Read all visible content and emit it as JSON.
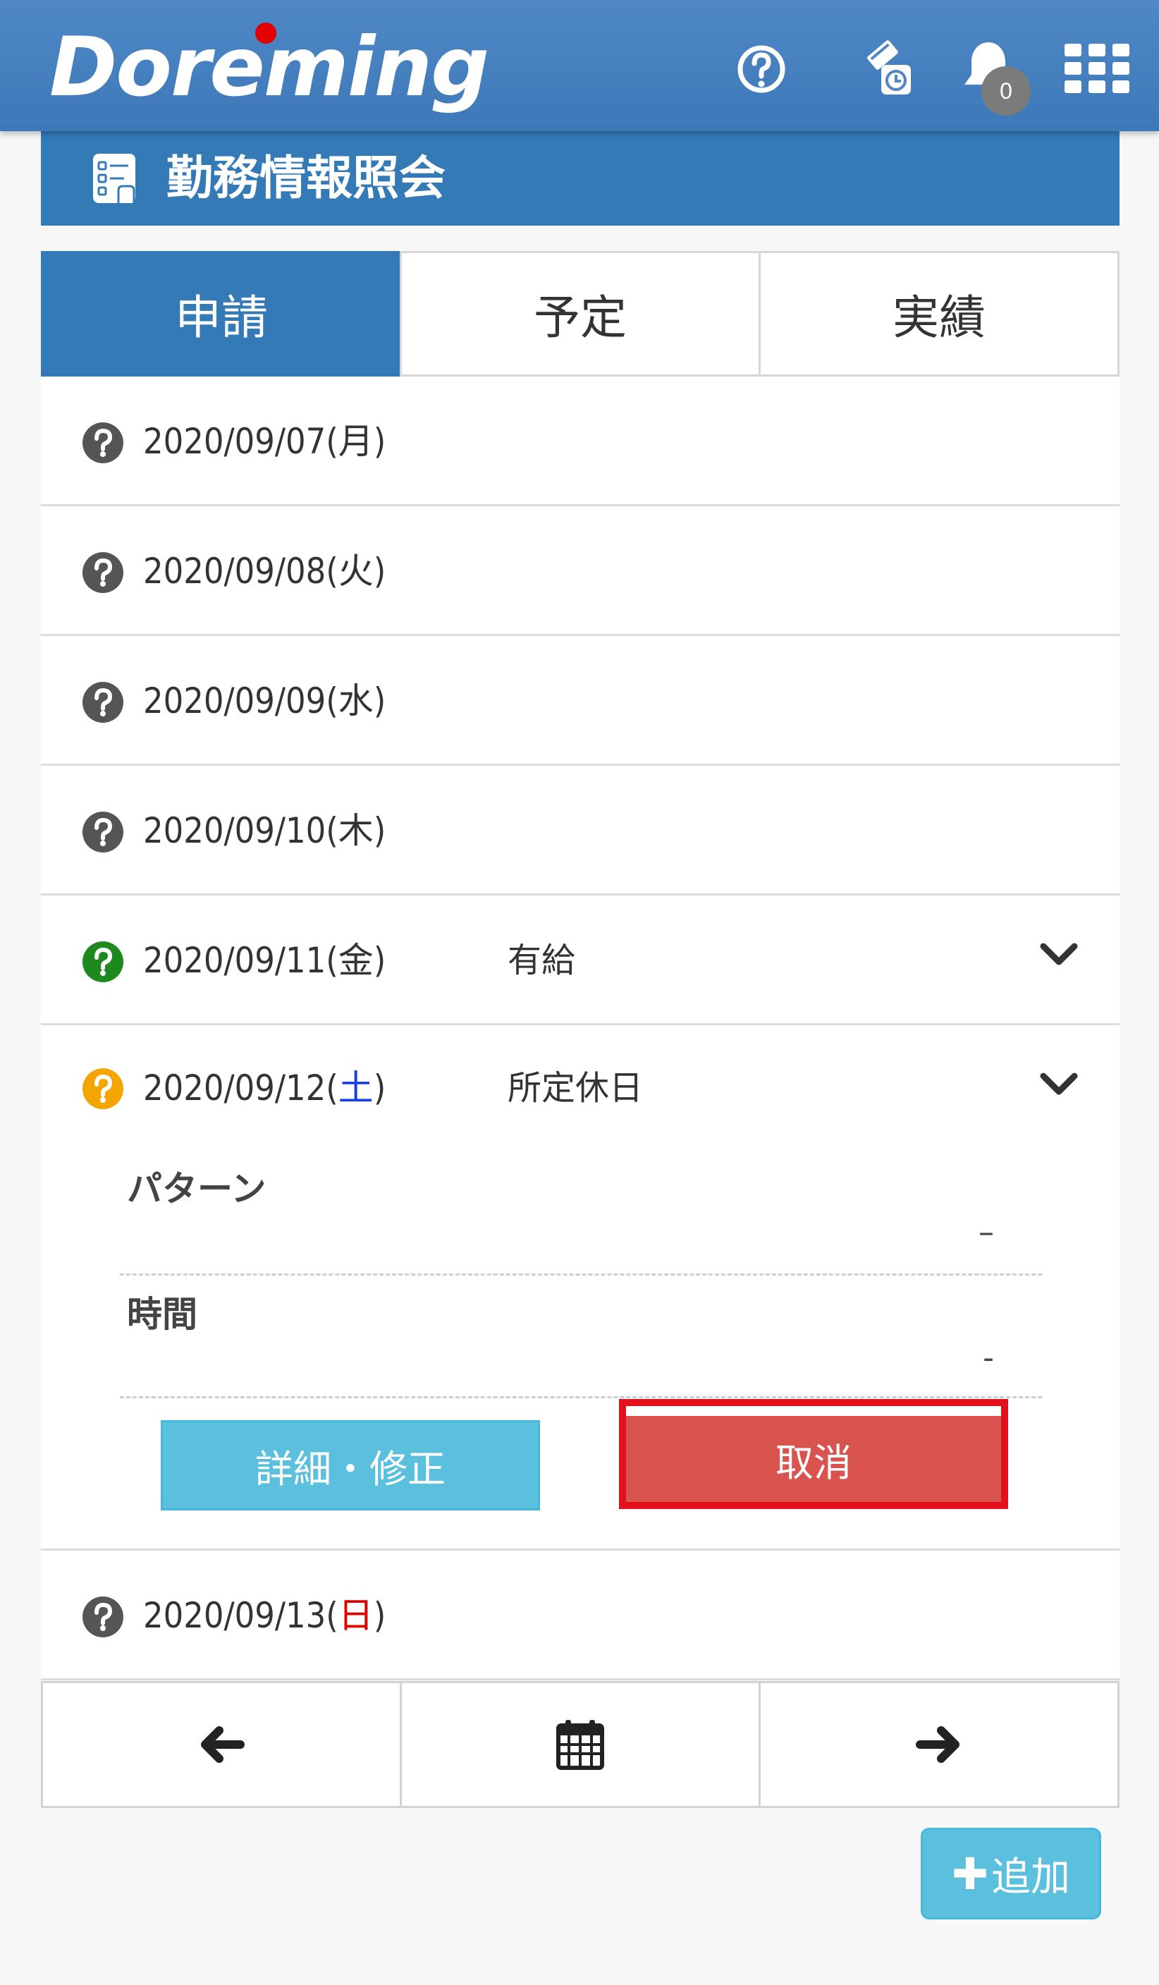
{
  "header": {
    "logo_text": "Doreming",
    "notification_count": "0"
  },
  "page": {
    "title": "勤務情報照会"
  },
  "tabs": [
    {
      "label": "申請",
      "active": true
    },
    {
      "label": "予定",
      "active": false
    },
    {
      "label": "実績",
      "active": false
    }
  ],
  "rows": [
    {
      "date": "2020/09/07",
      "weekday": "月",
      "kind": "",
      "status": "unknown"
    },
    {
      "date": "2020/09/08",
      "weekday": "火",
      "kind": "",
      "status": "unknown"
    },
    {
      "date": "2020/09/09",
      "weekday": "水",
      "kind": "",
      "status": "unknown"
    },
    {
      "date": "2020/09/10",
      "weekday": "木",
      "kind": "",
      "status": "unknown"
    },
    {
      "date": "2020/09/11",
      "weekday": "金",
      "kind": "有給",
      "status": "approved"
    },
    {
      "date": "2020/09/12",
      "weekday": "土",
      "kind": "所定休日",
      "status": "pending"
    },
    {
      "date": "2020/09/13",
      "weekday": "日",
      "kind": "",
      "status": "unknown"
    }
  ],
  "detail": {
    "pattern_label": "パターン",
    "pattern_value": "–",
    "time_label": "時間",
    "time_value": "-",
    "edit_button": "詳細・修正",
    "cancel_button": "取消"
  },
  "nav": {
    "add_button": "追加"
  },
  "colors": {
    "header": "#3d78b9",
    "primary": "#337ab7",
    "info": "#5bc0de",
    "danger": "#d9534f",
    "highlight_border": "#e3111b",
    "status_unknown": "#555555",
    "status_approved": "#1e8a1e",
    "status_pending": "#f5a500",
    "saturday": "#1a3fe0",
    "sunday": "#e00000"
  }
}
